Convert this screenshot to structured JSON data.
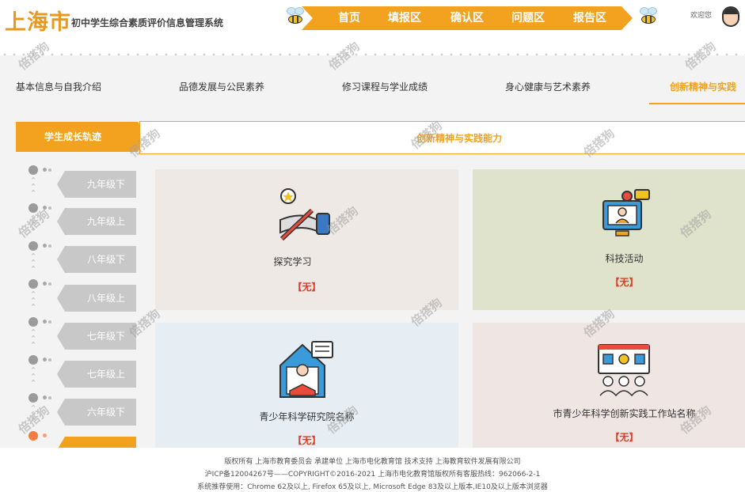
{
  "header": {
    "logo": "上海市",
    "subtitle": "初中学生综合素质评价信息管理系统",
    "nav": [
      "首页",
      "填报区",
      "确认区",
      "问题区",
      "报告区"
    ],
    "welcome": "欢迎您"
  },
  "tabs": [
    {
      "label": "基本信息与自我介绍"
    },
    {
      "label": "品德发展与公民素养"
    },
    {
      "label": "修习课程与学业成绩"
    },
    {
      "label": "身心健康与艺术素养"
    },
    {
      "label": "创新精神与实践"
    }
  ],
  "sidebar": {
    "title": "学生成长轨迹",
    "grades": [
      "九年级下",
      "九年级上",
      "八年级下",
      "八年级上",
      "七年级下",
      "七年级上",
      "六年级下"
    ]
  },
  "content": {
    "title": "创新精神与实践能力",
    "cards": [
      {
        "title": "探究学习",
        "status": "【无】",
        "icon": "pen-writing-icon"
      },
      {
        "title": "科技活动",
        "status": "【无】",
        "icon": "computer-presentation-icon"
      },
      {
        "title": "青少年科学研究院名称",
        "status": "【无】",
        "icon": "reading-student-icon"
      },
      {
        "title": "市青少年科学创新实践工作站名称",
        "status": "【无】",
        "icon": "group-meeting-icon"
      }
    ]
  },
  "footer": {
    "line1": "版权所有 上海市教育委员会    承建单位 上海市电化教育馆    技术支持 上海教育软件发展有限公司",
    "line2": "沪ICP备12004267号——COPYRIGHT©2016-2021 上海市电化教育馆版权所有客服热线：962066-2-1",
    "line3": "系统推荐使用：Chrome 62及以上, Firefox 65及以上, Microsoft Edge 83及以上版本,IE10及以上版本浏览器"
  },
  "watermark": "倍搭狗",
  "colors": {
    "accent": "#f2a21f",
    "status": "#e23b2b",
    "sidebar_grey": "#c8c8c8"
  }
}
